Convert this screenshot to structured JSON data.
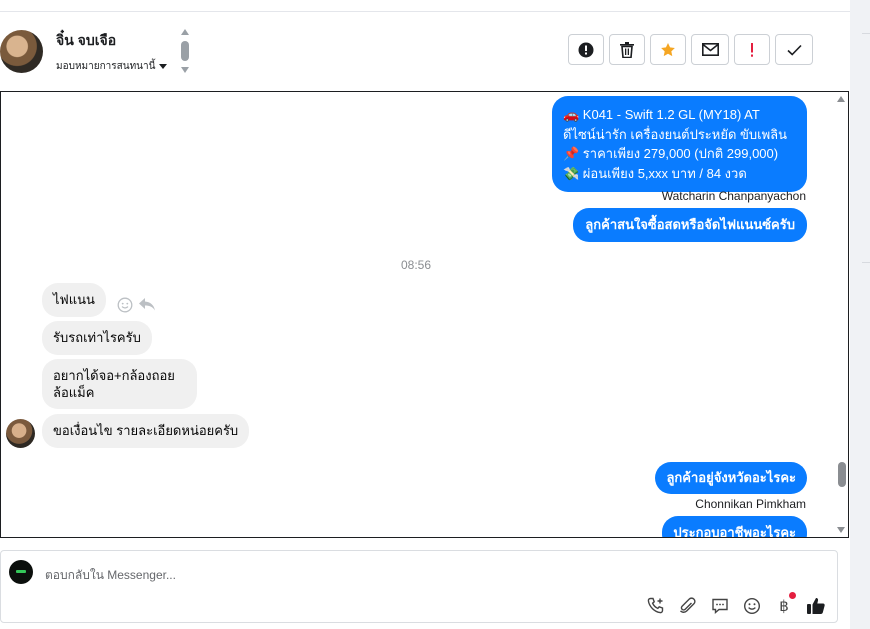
{
  "header": {
    "contact_name": "จิ๋น จบเจือ",
    "assign_label": "มอบหมายการสนทนานี้",
    "actions": [
      {
        "name": "alert-button",
        "icon": "alert-circle-icon",
        "color": "#1c1e21"
      },
      {
        "name": "delete-button",
        "icon": "trash-icon",
        "color": "#1c1e21"
      },
      {
        "name": "star-button",
        "icon": "star-icon",
        "color": "#f5a623"
      },
      {
        "name": "mail-button",
        "icon": "envelope-icon",
        "color": "#1c1e21"
      },
      {
        "name": "spam-button",
        "icon": "exclamation-icon",
        "color": "#e41e3f"
      },
      {
        "name": "done-button",
        "icon": "check-icon",
        "color": "#1c1e21"
      }
    ]
  },
  "thread": {
    "offer_lines": [
      "🚗 K041 - Swift 1.2 GL (MY18) AT",
      "ดีไซน์น่ารัก เครื่องยนต์ประหยัด ขับเพลิน",
      "📌 ราคาเพียง 279,000 (ปกติ 299,000)",
      "💸 ผ่อนเพียง 5,xxx บาท / 84 งวด"
    ],
    "offer_sender": "Watcharin Chanpanyachon",
    "out_msg_1": "ลูกค้าสนใจซื้อสดหรือจัดไฟแนนซ์ครับ",
    "timestamp": "08:56",
    "in_messages": [
      "ไฟแนน",
      "รับรถเท่าไรครับ",
      "อยากได้จอ+กล้องถอยล้อแม็ค",
      "ขอเงื่อนไข รายละเอียดหน่อยครับ"
    ],
    "out_msg_2": "ลูกค้าอยู่จังหวัดอะไรคะ",
    "out_msg_2_sender": "Chonnikan Pimkham",
    "out_msg_3": "ประกอบอาชีพอะไรคะ"
  },
  "composer": {
    "placeholder": "ตอบกลับใน Messenger...",
    "baht_symbol": "฿",
    "tools": [
      "phone-plus-icon",
      "paperclip-icon",
      "saved-reply-icon",
      "emoji-icon",
      "baht-icon",
      "thumbs-up-icon"
    ]
  }
}
